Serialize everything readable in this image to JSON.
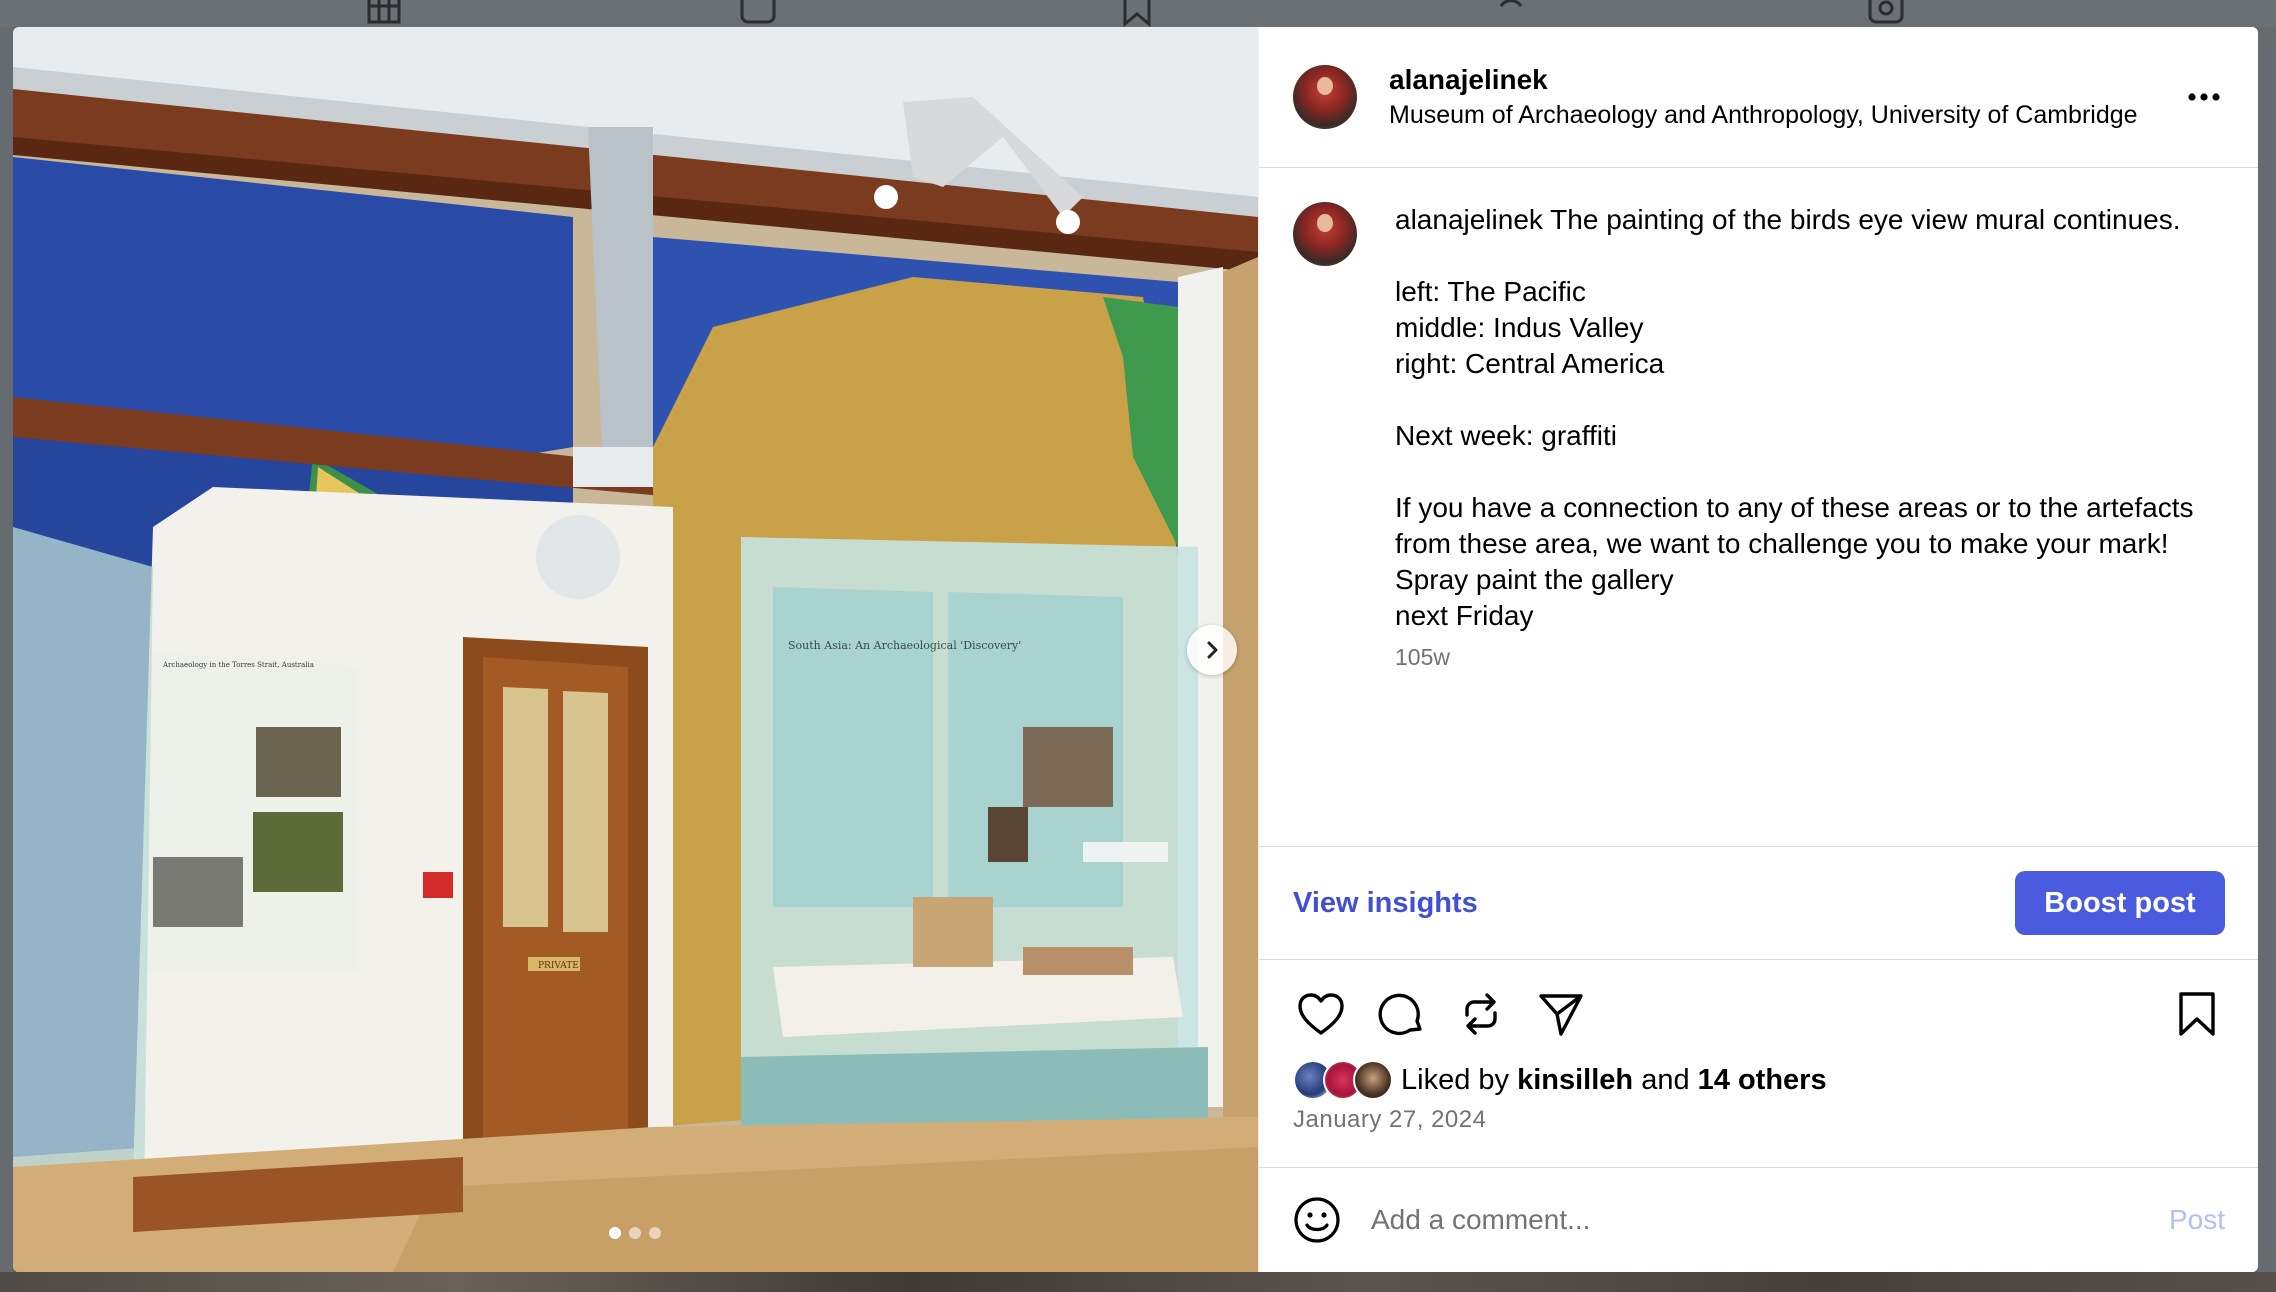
{
  "post": {
    "username": "alanajelinek",
    "location": "Museum of Archaeology and Anthropology, University of Cambridge",
    "more_icon": "more-horizontal-icon",
    "caption_user": "alanajelinek",
    "caption_text": " The painting of the birds eye view mural continues.\n\nleft: The Pacific\nmiddle: Indus Valley\nright: Central America\n\nNext week: graffiti\n\nIf you have a connection to any of these areas or to the artefacts from these area, we want to challenge you to make your mark!\nSpray paint the gallery\nnext Friday",
    "age": "105w",
    "date": "January 27, 2024"
  },
  "insights": {
    "view_label": "View insights",
    "boost_label": "Boost post"
  },
  "likes": {
    "prefix": "Liked by",
    "user": "kinsilleh",
    "joiner": "and",
    "others": "14 others"
  },
  "comment": {
    "placeholder": "Add a comment...",
    "post_label": "Post"
  },
  "carousel": {
    "slide_count": 3,
    "active_index": 0
  },
  "photo_labels": {
    "case_title": "South Asia: An Archaeological 'Discovery'",
    "panel_title": "Archaeology in the Torres Strait, Australia",
    "door_sign": "PRIVATE"
  },
  "colors": {
    "accent_link": "#4150d3",
    "boost_button": "#4a5bdf",
    "post_disabled": "#b3bff5",
    "muted_text": "#737373"
  }
}
